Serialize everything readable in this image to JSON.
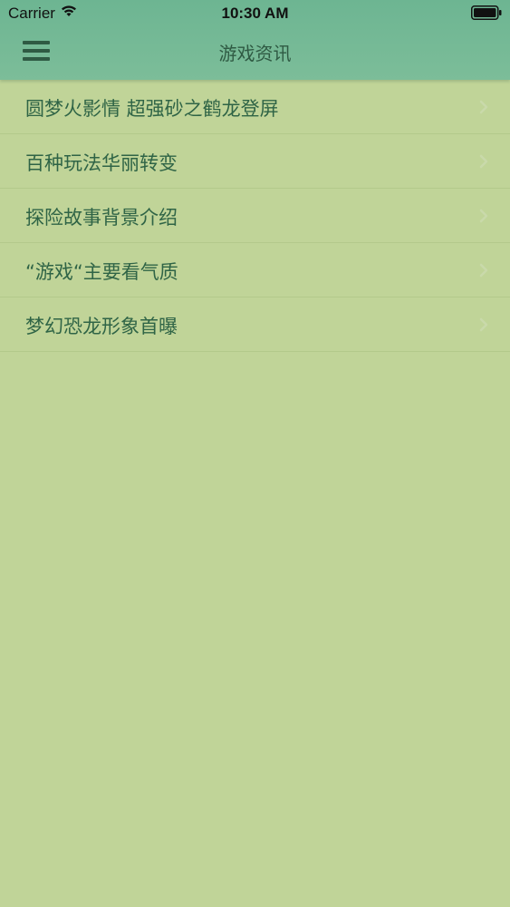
{
  "status_bar": {
    "carrier": "Carrier",
    "time": "10:30 AM",
    "icons": [
      "wifi-icon",
      "battery-icon"
    ]
  },
  "nav": {
    "title": "游戏资讯",
    "menu_icon": "hamburger-menu-icon"
  },
  "list": {
    "items": [
      {
        "label": "圆梦火影情 超强砂之鹤龙登屏"
      },
      {
        "label": "百种玩法华丽转变"
      },
      {
        "label": "探险故事背景介绍"
      },
      {
        "label": "“游戏“主要看气质"
      },
      {
        "label": "梦幻恐龙形象首曝"
      }
    ]
  },
  "colors": {
    "background": "#c0d498",
    "header": "#73b995",
    "title_text": "#2f5a43",
    "item_text": "#2f6446",
    "separator": "#b3c98b"
  }
}
